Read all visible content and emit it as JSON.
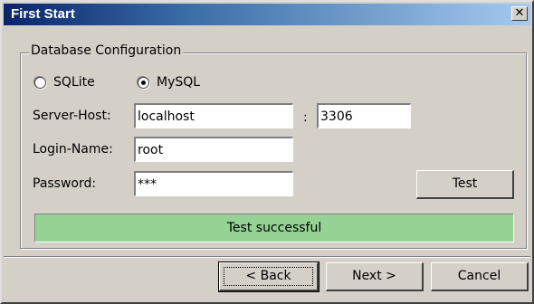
{
  "window": {
    "title": "First Start",
    "close_glyph": "✕"
  },
  "group": {
    "legend": "Database Configuration"
  },
  "db_type": {
    "options": [
      {
        "label": "SQLite",
        "checked": false
      },
      {
        "label": "MySQL",
        "checked": true
      }
    ]
  },
  "fields": {
    "server_host": {
      "label": "Server-Host:",
      "value": "localhost"
    },
    "port": {
      "separator": ":",
      "value": "3306"
    },
    "login_name": {
      "label": "Login-Name:",
      "value": "root"
    },
    "password": {
      "label": "Password:",
      "value": "***"
    }
  },
  "buttons": {
    "test": "Test",
    "back": "< Back",
    "next": "Next >",
    "cancel": "Cancel"
  },
  "status": {
    "text": "Test successful",
    "color": "#94d394"
  },
  "colors": {
    "title_start": "#0a246a",
    "title_end": "#a6caf0",
    "face": "#d4d0c8"
  }
}
